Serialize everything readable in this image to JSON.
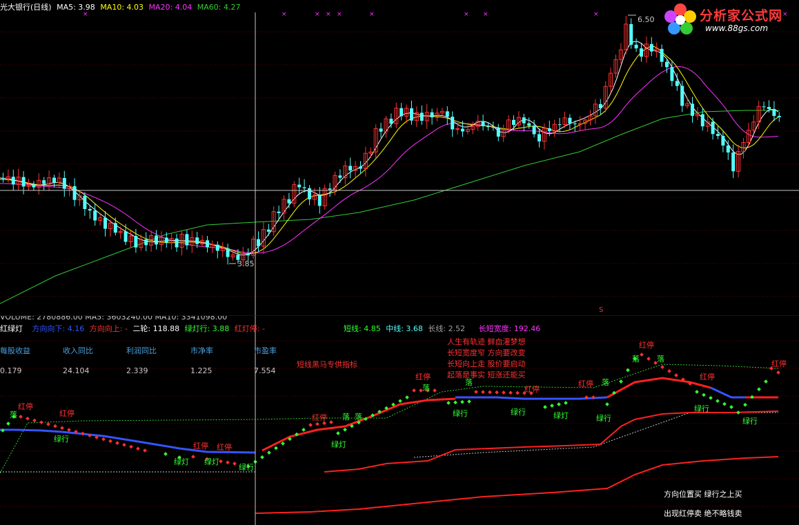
{
  "main_panel": {
    "stock_title": "光大银行(日线)",
    "ma5_label": "MA5: 3.98",
    "ma10_label": "MA10: 4.03",
    "ma20_label": "MA20: 4.04",
    "ma60_label": "MA60: 4.27",
    "high_label": "6.50",
    "low_label": "3.85",
    "s_marker": "S",
    "colors": {
      "ma5": "#ffffff",
      "ma10": "#ffff00",
      "ma20": "#ff33ff",
      "ma60": "#33cc33",
      "up": "#ff3333",
      "down": "#54ffff"
    }
  },
  "volume_header": {
    "text": "VOLUME: 2780886.00  MA5: 3603240.00  MA10: 3341098.00"
  },
  "indicator_header": {
    "name": "红绿灯",
    "direction_down": "方向向下: 4.16",
    "direction_up": "方向向上: -",
    "second_wheel": "二轮: 118.88",
    "green_light": "绿灯行: 3.88",
    "red_light": "红灯停: -",
    "short_line": "短线: 4.85",
    "mid_line": "中线: 3.68",
    "long_line": "长线: 2.52",
    "width": "长短宽度: 192.46"
  },
  "fin_table": {
    "headers": [
      "每股收益",
      "收入同比",
      "利润同比",
      "市净率",
      "市盈率"
    ],
    "values": [
      "0.179",
      "24.104",
      "2.339",
      "1.225",
      "7.554"
    ]
  },
  "notes": {
    "special": "短线黑马专供指标",
    "line1": "人生有轨迹 鲜血灌梦想",
    "line2": "长短宽度窄 方向要改变",
    "line3": "长短向上走 股价要启动",
    "line4": "起落是事实 短涨还能买"
  },
  "signal_labels": {
    "red_stop": "红停",
    "green_go": "绿行",
    "green_light": "绿灯",
    "fall": "落"
  },
  "footer": {
    "line1": "方向位置买 绿行之上买",
    "line2": "出现红停卖 绝不略钱卖"
  },
  "logo": {
    "name": "分析家公式网",
    "url": "www.88gs.com"
  }
}
